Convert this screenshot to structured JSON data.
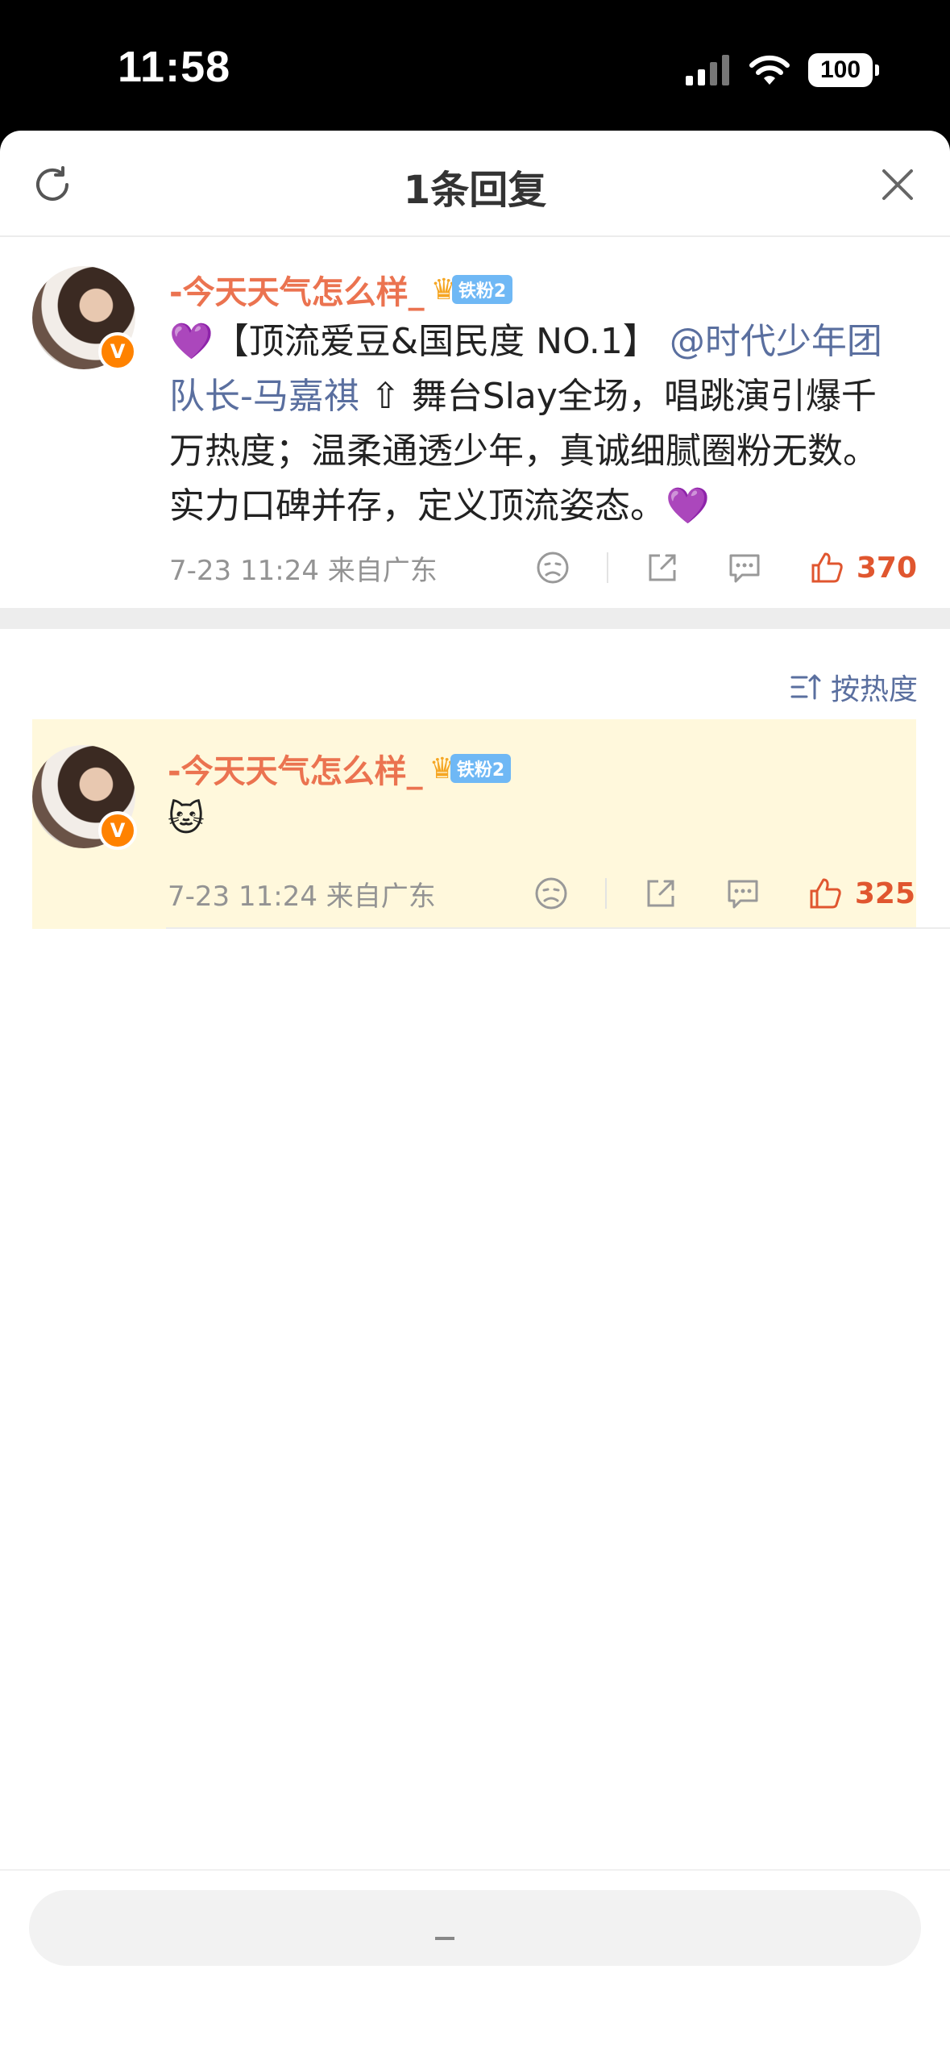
{
  "status_bar": {
    "time": "11:58",
    "battery": "100"
  },
  "header": {
    "title": "1条回复",
    "refresh_icon": "refresh-icon",
    "close_icon": "close-icon"
  },
  "main_comment": {
    "username": "-今天天气怎么样_",
    "fan_badge": "铁粉2",
    "content_prefix": "💜【顶流爱豆&国民度 NO.1】",
    "mention": "@时代少年团队长-马嘉祺",
    "content_suffix": "⇧ 舞台Slay全场，唱跳演引爆千万热度；温柔通透少年，真诚细腻圈粉无数。实力口碑并存，定义顶流姿态。💜",
    "meta": "7-23 11:24  来自广东",
    "like_count": "370"
  },
  "sort": {
    "label": "按热度"
  },
  "reply": {
    "username": "-今天天气怎么样_",
    "fan_badge": "铁粉2",
    "content": "🐱",
    "meta": "7-23 11:24  来自广东",
    "like_count": "325"
  },
  "colors": {
    "username": "#eb7350",
    "mention": "#5a6f9f",
    "like": "#e0562f",
    "highlight": "#fff8dc"
  }
}
